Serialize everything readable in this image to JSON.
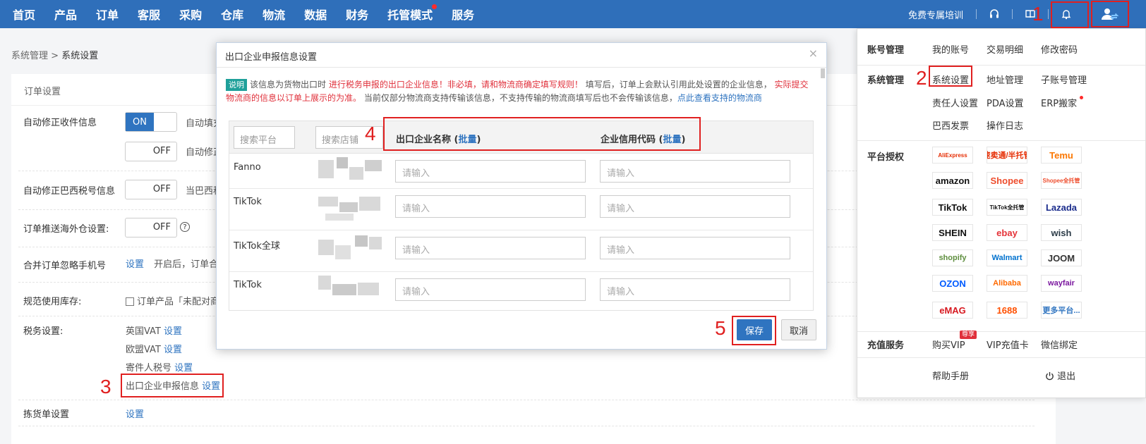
{
  "nav": {
    "items": [
      "首页",
      "产品",
      "订单",
      "客服",
      "采购",
      "仓库",
      "物流",
      "数据",
      "财务",
      "托管模式",
      "服务"
    ],
    "training": "免费专属培训"
  },
  "breadcrumb": {
    "parent": "系统管理",
    "separator": ">",
    "current": "系统设置"
  },
  "panel": {
    "title": "订单设置",
    "rows": {
      "auto_fix_receiver": {
        "label": "自动修正收件信息",
        "on": "ON",
        "off": "OFF",
        "desc1": "自动填充",
        "desc2": "自动修正"
      },
      "auto_fix_brazil_tax": {
        "label": "自动修正巴西税号信息",
        "off": "OFF",
        "desc": "当巴西税"
      },
      "push_overseas": {
        "label": "订单推送海外仓设置:",
        "off": "OFF",
        "help": "?"
      },
      "merge_ignore_phone": {
        "label": "合并订单忽略手机号",
        "link": "设置",
        "desc": "开启后，订单合"
      },
      "standard_stock": {
        "label": "规范使用库存:",
        "desc": "订单产品「未配对商"
      },
      "tax": {
        "label": "税务设置:",
        "uk_vat": "英国VAT",
        "eu_vat": "欧盟VAT",
        "sender_tax": "寄件人税号",
        "export_info": "出口企业申报信息",
        "setup": "设置"
      },
      "pick_list": {
        "label": "拣货单设置",
        "link": "设置"
      }
    }
  },
  "modal": {
    "title": "出口企业申报信息设置",
    "close": "×",
    "note_tag": "说明",
    "note_1": "该信息为货物出口时",
    "note_red_1": "进行税务申报的出口企业信息！非必填，请和物流商确定填写规则！",
    "note_2": "填写后，订单上会默认引用此处设置的企业信息，",
    "note_red_2": "实际提交物流商的信息以订单上展示的为准。",
    "note_3": "当前仅部分物流商支持传输该信息，不支持传输的物流商填写后也不会传输该信息，",
    "note_link": "点此查看支持的物流商",
    "search_platform": "搜索平台",
    "search_shop": "搜索店铺",
    "col_name": "出口企业名称",
    "col_code": "企业信用代码",
    "batch": "批量",
    "input_placeholder": "请输入",
    "rows": [
      {
        "platform": "Fanno"
      },
      {
        "platform": "TikTok"
      },
      {
        "platform": "TikTok全球"
      },
      {
        "platform": "TikTok"
      }
    ],
    "save": "保存",
    "cancel": "取消"
  },
  "dropdown": {
    "account_title": "账号管理",
    "account_items": [
      "我的账号",
      "交易明细",
      "修改密码"
    ],
    "system_title": "系统管理",
    "system_items": [
      "系统设置",
      "地址管理",
      "子账号管理",
      "责任人设置",
      "PDA设置",
      "ERP搬家",
      "巴西发票",
      "操作日志"
    ],
    "platform_title": "平台授权",
    "platforms": [
      {
        "name": "AliExpress",
        "color": "#e62e04"
      },
      {
        "name": "速卖通/半托管",
        "color": "#e62e04"
      },
      {
        "name": "Temu",
        "color": "#fb7701"
      },
      {
        "name": "amazon",
        "color": "#111111"
      },
      {
        "name": "Shopee",
        "color": "#ee4d2d"
      },
      {
        "name": "Shopee全托管",
        "color": "#ee4d2d"
      },
      {
        "name": "TikTok",
        "color": "#111111"
      },
      {
        "name": "TikTok全托管",
        "color": "#111111"
      },
      {
        "name": "Lazada",
        "color": "#1a2c8c"
      },
      {
        "name": "SHEIN",
        "color": "#111111"
      },
      {
        "name": "ebay",
        "color": "#e53238"
      },
      {
        "name": "wish",
        "color": "#2c3c48"
      },
      {
        "name": "shopify",
        "color": "#5e8e3e"
      },
      {
        "name": "Walmart",
        "color": "#0071ce"
      },
      {
        "name": "JOOM",
        "color": "#333333"
      },
      {
        "name": "OZON",
        "color": "#005bff"
      },
      {
        "name": "Alibaba",
        "color": "#ff6a00"
      },
      {
        "name": "wayfair",
        "color": "#7b189f"
      },
      {
        "name": "eMAG",
        "color": "#d71920"
      },
      {
        "name": "1688",
        "color": "#ff5000"
      },
      {
        "name": "更多平台...",
        "color": "#2f74c0"
      }
    ],
    "recharge_title": "充值服务",
    "recharge_items": [
      "购买VIP",
      "VIP充值卡",
      "微信绑定"
    ],
    "vip_badge": "尊享",
    "help": "帮助手册",
    "logout": "退出"
  },
  "annotations": [
    "1",
    "2",
    "3",
    "4",
    "5"
  ]
}
